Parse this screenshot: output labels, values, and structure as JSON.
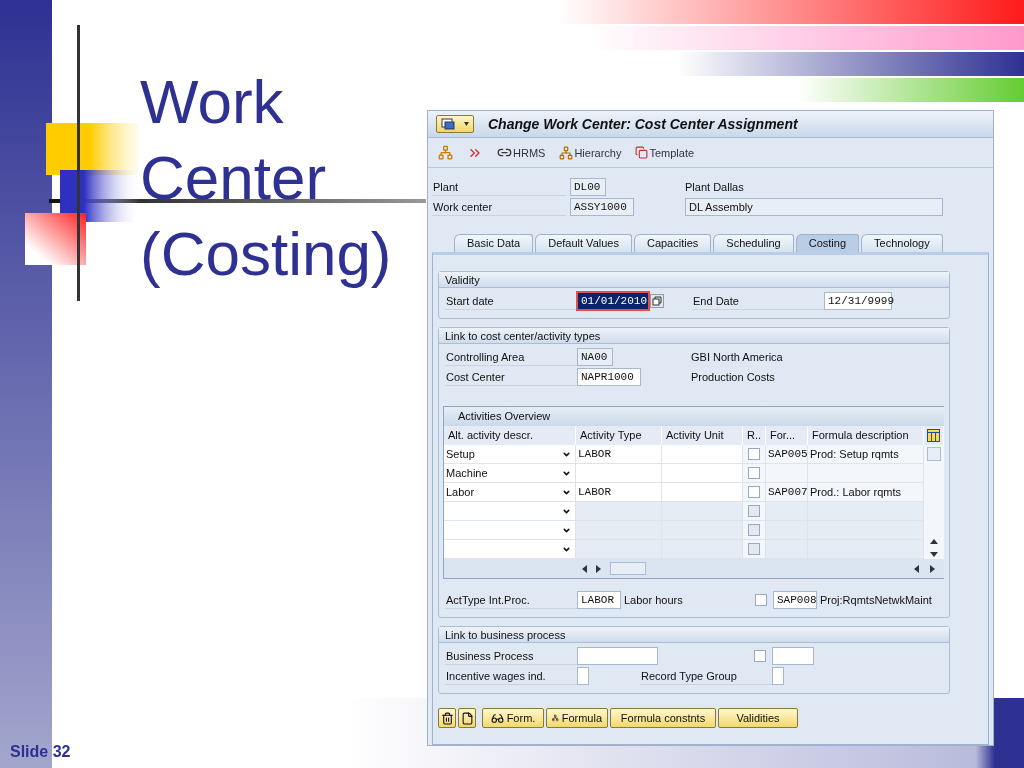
{
  "slide": {
    "title": "Work Center (Costing)",
    "number": "Slide 32"
  },
  "window": {
    "title": "Change Work Center: Cost Center Assignment",
    "toolbar": [
      {
        "kind": "up"
      },
      {
        "kind": "forward"
      },
      {
        "kind": "link",
        "label": "HRMS"
      },
      {
        "kind": "hierarchy",
        "label": "Hierarchy"
      },
      {
        "kind": "template",
        "label": "Template"
      }
    ],
    "header": [
      {
        "label": "Plant",
        "value": "DL00",
        "description": "Plant Dallas",
        "boxed": false
      },
      {
        "label": "Work center",
        "value": "ASSY1000",
        "description": "DL Assembly",
        "boxed": true
      }
    ],
    "tabs": [
      {
        "label": "Basic Data",
        "selected": false
      },
      {
        "label": "Default Values",
        "selected": false
      },
      {
        "label": "Capacities",
        "selected": false
      },
      {
        "label": "Scheduling",
        "selected": false
      },
      {
        "label": "Costing",
        "selected": true
      },
      {
        "label": "Technology",
        "selected": false
      }
    ],
    "validity": {
      "title": "Validity",
      "start": {
        "label": "Start date",
        "value": "01/01/2010",
        "focused": true
      },
      "end": {
        "label": "End Date",
        "value": "12/31/9999",
        "focused": false
      }
    },
    "link": {
      "title": "Link to cost center/activity types",
      "fields": [
        {
          "label": "Controlling Area",
          "value": "NA00",
          "editable": false,
          "text": "GBI North America"
        },
        {
          "label": "Cost Center",
          "value": "NAPR1000",
          "editable": true,
          "text": "Production Costs"
        }
      ],
      "table": {
        "title": "Activities Overview",
        "columns": [
          "Alt. activity descr.",
          "Activity Type",
          "Activity Unit",
          "R..",
          "For...",
          "Formula description"
        ],
        "rows": [
          {
            "alt": "Setup",
            "type": "LABOR",
            "checked": false,
            "formula": "SAP005",
            "description": "Prod: Setup rqmts",
            "disabled": false
          },
          {
            "alt": "Machine",
            "checked": false,
            "disabled": false
          },
          {
            "alt": "Labor",
            "type": "LABOR",
            "checked": false,
            "formula": "SAP007",
            "description": "Prod.: Labor rqmts",
            "disabled": false
          },
          {
            "checked": false,
            "disabled": true
          },
          {
            "checked": false,
            "disabled": true
          },
          {
            "checked": false,
            "disabled": true
          }
        ]
      },
      "int_proc": {
        "label": "ActType Int.Proc.",
        "value": "LABOR",
        "text": "Labor hours",
        "checked": false,
        "formula": "SAP008",
        "description": "Proj:RqmtsNetwkMaint"
      }
    },
    "business": {
      "title": "Link to business process",
      "process_label": "Business Process",
      "checked": false,
      "wages_label": "Incentive wages ind.",
      "record_label": "Record Type Group"
    },
    "buttons": [
      {
        "kind": "delete"
      },
      {
        "kind": "new"
      },
      {
        "kind": "glasses",
        "label": "Form."
      },
      {
        "kind": "formula",
        "label": "Formula"
      },
      {
        "kind": "plain",
        "label": "Formula constnts"
      },
      {
        "kind": "plain",
        "label": "Validities"
      }
    ]
  }
}
